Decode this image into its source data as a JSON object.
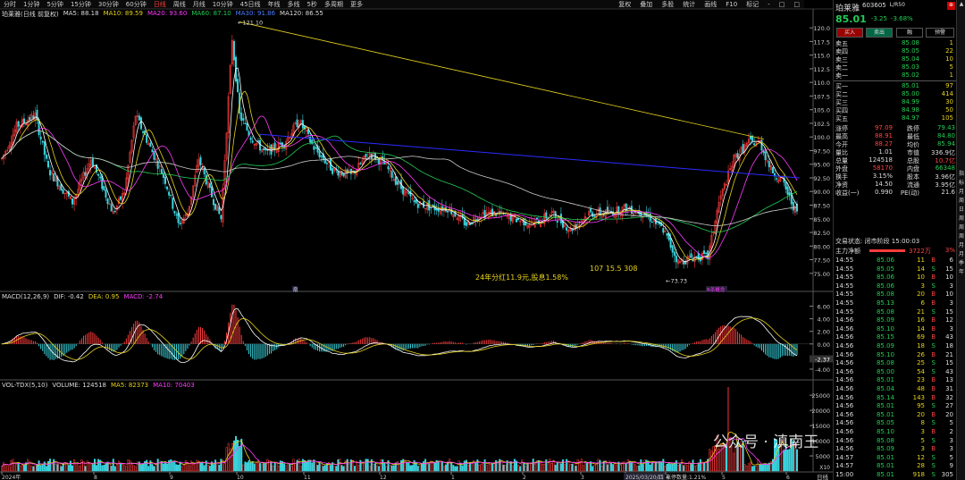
{
  "toolbar": {
    "items": [
      "分时",
      "1分钟",
      "5分钟",
      "15分钟",
      "30分钟",
      "60分钟",
      "日线",
      "周线",
      "月线",
      "10分钟",
      "45日线",
      "年线",
      "多线",
      "5秒",
      "多周期",
      "更多"
    ],
    "active_index": 6,
    "right_items": [
      "复权",
      "叠加",
      "多股",
      "统计",
      "画线",
      "F10",
      "标记",
      "-",
      "□",
      "□"
    ]
  },
  "main_header": {
    "name": "珀莱雅(日线 前复权)",
    "ma5": "MA5: 88.18",
    "ma10": "MA10: 89.59",
    "ma20": "MA20: 93.60",
    "ma60": "MA60: 87.10",
    "ma30": "MA30: 91.86",
    "ma120": "MA120: 86.55"
  },
  "annotations": {
    "high": "121.10",
    "low": "73.73",
    "dividend": "24年分红11.9元,股息1.58%",
    "misc": "107 15.5 308",
    "marker1": "扇",
    "marker2": "R杀概念"
  },
  "price_axis": [
    "120.0",
    "117.5",
    "115.0",
    "112.5",
    "110.0",
    "107.5",
    "105.0",
    "102.5",
    "100.0",
    "97.50",
    "95.00",
    "92.50",
    "90.00",
    "87.50",
    "85.00",
    "82.50",
    "80.00",
    "77.50",
    "75.00"
  ],
  "macd_header": {
    "name": "MACD(12,26,9)",
    "dif": "DIF: -0.42",
    "dea": "DEA: 0.95",
    "macd": "MACD: -2.74"
  },
  "macd_axis": [
    "6.00",
    "4.00",
    "2.00",
    "0.00",
    "-2.00",
    "-4.00"
  ],
  "macd_current": "-2.37",
  "vol_header": {
    "name": "VOL-TDX(5,10)",
    "volume": "VOLUME: 124518",
    "ma5": "MA5: 82373",
    "ma10": "MA10: 70403"
  },
  "vol_axis": [
    "25000",
    "20000",
    "15000",
    "10000",
    "5000"
  ],
  "vol_unit": "X10",
  "time_axis": [
    "2024年",
    "8",
    "9",
    "10",
    "11",
    "12",
    "1",
    "2",
    "3",
    "2025/03/20/四",
    "4",
    "5",
    "6"
  ],
  "time_axis_extra": "涨停数量:1.21%",
  "bottom_right_label": "日线",
  "watermark": "公众号 · 滇南王",
  "panel": {
    "stock_name": "珀莱雅",
    "stock_code": "603605",
    "tag": "L/R50",
    "price": "85.01",
    "change": "-3.25",
    "pct": "-3.68%",
    "buttons": [
      "买入",
      "卖出",
      "融",
      "预警"
    ],
    "asks": [
      {
        "label": "卖五",
        "price": "85.08",
        "vol": "1"
      },
      {
        "label": "卖四",
        "price": "85.05",
        "vol": "22"
      },
      {
        "label": "卖三",
        "price": "85.04",
        "vol": "10"
      },
      {
        "label": "卖二",
        "price": "85.03",
        "vol": "5"
      },
      {
        "label": "卖一",
        "price": "85.02",
        "vol": "1"
      }
    ],
    "bids": [
      {
        "label": "买一",
        "price": "85.01",
        "vol": "97"
      },
      {
        "label": "买二",
        "price": "85.00",
        "vol": "414"
      },
      {
        "label": "买三",
        "price": "84.99",
        "vol": "30"
      },
      {
        "label": "买四",
        "price": "84.98",
        "vol": "50"
      },
      {
        "label": "买五",
        "price": "84.97",
        "vol": "105"
      }
    ],
    "stats": [
      [
        "涨停",
        "97.09",
        "跌停",
        "79.43"
      ],
      [
        "最高",
        "88.91",
        "最低",
        "84.80"
      ],
      [
        "今开",
        "88.27",
        "均价",
        "85.94"
      ],
      [
        "量比",
        "1.01",
        "市值",
        "336.9亿"
      ],
      [
        "总量",
        "124518",
        "总股",
        "10.7亿"
      ],
      [
        "外盘",
        "58170",
        "内盘",
        "66348"
      ],
      [
        "换手",
        "3.15%",
        "股本",
        "3.96亿"
      ],
      [
        "净资",
        "14.50",
        "流通",
        "3.95亿"
      ],
      [
        "收益(一)",
        "0.990",
        "PE(动)",
        "21.6"
      ]
    ],
    "status_label": "交易状态: 闭市阶段 15:00:03",
    "main_flow_label": "主力净额",
    "main_flow_value": "3722万",
    "main_flow_pct": "3%",
    "ticks": [
      [
        "14:55",
        "85.06",
        "11",
        "B",
        "6"
      ],
      [
        "14:55",
        "85.05",
        "14",
        "S",
        "15"
      ],
      [
        "14:55",
        "85.06",
        "10",
        "B",
        "10"
      ],
      [
        "14:55",
        "85.06",
        "3",
        "S",
        "3"
      ],
      [
        "14:55",
        "85.08",
        "20",
        "B",
        "10"
      ],
      [
        "14:55",
        "85.13",
        "6",
        "B",
        "3"
      ],
      [
        "14:55",
        "85.08",
        "21",
        "S",
        "15"
      ],
      [
        "14:56",
        "85.09",
        "16",
        "B",
        "12"
      ],
      [
        "14:56",
        "85.10",
        "14",
        "B",
        "3"
      ],
      [
        "14:56",
        "85.15",
        "69",
        "B",
        "43"
      ],
      [
        "14:56",
        "85.09",
        "18",
        "S",
        "18"
      ],
      [
        "14:56",
        "85.10",
        "26",
        "B",
        "21"
      ],
      [
        "14:56",
        "85.08",
        "25",
        "S",
        "15"
      ],
      [
        "14:56",
        "85.00",
        "54",
        "S",
        "43"
      ],
      [
        "14:56",
        "85.01",
        "23",
        "B",
        "13"
      ],
      [
        "14:56",
        "85.04",
        "48",
        "B",
        "31"
      ],
      [
        "14:56",
        "85.14",
        "143",
        "B",
        "32"
      ],
      [
        "14:56",
        "85.01",
        "95",
        "S",
        "27"
      ],
      [
        "14:56",
        "85.01",
        "20",
        "B",
        "20"
      ],
      [
        "14:56",
        "85.05",
        "8",
        "S",
        "5"
      ],
      [
        "14:56",
        "85.10",
        "3",
        "B",
        "2"
      ],
      [
        "14:56",
        "85.08",
        "5",
        "S",
        "3"
      ],
      [
        "14:56",
        "85.09",
        "3",
        "B",
        "3"
      ],
      [
        "14:57",
        "85.01",
        "12",
        "S",
        "5"
      ],
      [
        "14:57",
        "85.01",
        "28",
        "S",
        "9"
      ],
      [
        "15:00",
        "85.01",
        "918",
        "S",
        "305"
      ]
    ]
  },
  "sidebar": [
    "指",
    "标",
    "月",
    "周",
    "日",
    "周",
    "周",
    "周",
    "月",
    "月",
    "季",
    "年"
  ],
  "colors": {
    "up": "#ff3b3b",
    "down": "#3ad6e0",
    "ma5": "#ffffff",
    "ma10": "#e6d21a",
    "ma20": "#ff3bff",
    "ma60": "#22cc55",
    "ma120": "#aaaaaa"
  }
}
